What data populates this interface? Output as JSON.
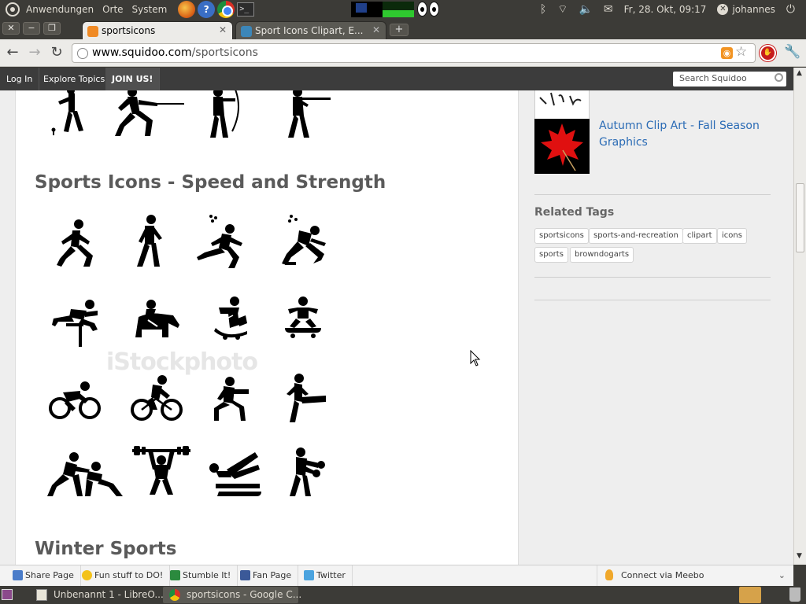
{
  "system_panel": {
    "menus": [
      "Anwendungen",
      "Orte",
      "System"
    ],
    "clock": "Fr, 28. Okt, 09:17",
    "user": "johannes"
  },
  "browser": {
    "tabs": [
      {
        "title": "sportsicons",
        "active": true
      },
      {
        "title": "Sport Icons Clipart, E...",
        "active": false
      }
    ],
    "url_host": "www.squidoo.com",
    "url_path": "/sportsicons"
  },
  "site_nav": {
    "items": [
      "Log In",
      "Explore Topics",
      "JOIN US!"
    ],
    "search_placeholder": "Search Squidoo"
  },
  "main": {
    "sections": [
      {
        "title": "Sports Icons - Speed and Strength"
      },
      {
        "title": "Winter Sports"
      }
    ],
    "watermark": "iStockphoto"
  },
  "sidebar": {
    "related_lens_title": "Autumn Clip Art - Fall Season Graphics",
    "related_tags_title": "Related Tags",
    "tags": [
      "sportsicons",
      "sports-and-recreation",
      "clipart",
      "icons",
      "sports",
      "browndogarts"
    ]
  },
  "share_bar": {
    "items": [
      "Share Page",
      "Fun stuff to DO!",
      "Stumble It!",
      "Fan Page",
      "Twitter"
    ],
    "meebo": "Connect via Meebo"
  },
  "taskbar": {
    "windows": [
      {
        "title": "Unbenannt 1 - LibreO..."
      },
      {
        "title": "sportsicons - Google C..."
      }
    ]
  }
}
